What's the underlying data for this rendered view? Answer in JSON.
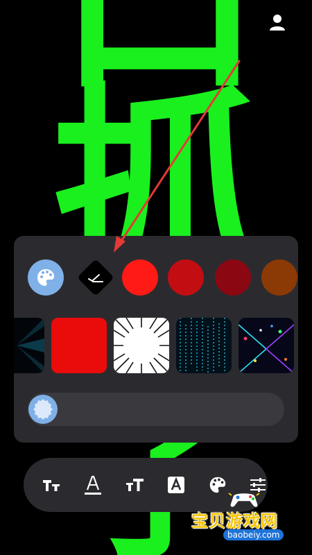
{
  "canvas": {
    "text_color": "#19f01e",
    "background": "#000000",
    "glyph_top": "口",
    "glyph_middle": "抓",
    "glyph_bottom": "了"
  },
  "header": {
    "profile_icon": "person-icon"
  },
  "annotation": {
    "arrow_color": "#e53935"
  },
  "color_panel": {
    "palette_icon": "palette-icon",
    "eyedropper_icon": "eyedropper-icon",
    "swatches": [
      "#ff1a16",
      "#c20d12",
      "#8b0712",
      "#8c3a05"
    ],
    "backgrounds": [
      "dark-burst",
      "solid-red",
      "white-speedlines",
      "blue-matrix",
      "neon-lines"
    ],
    "slider_icon": "blob-knob-icon"
  },
  "toolbar": {
    "tools": [
      "text-size-icon",
      "text-underline-color-icon",
      "font-case-icon",
      "text-box-icon",
      "palette-icon",
      "adjust-sliders-icon"
    ]
  },
  "watermark": {
    "brand_cn": "宝贝游戏网",
    "url": "baobeiy.com"
  }
}
